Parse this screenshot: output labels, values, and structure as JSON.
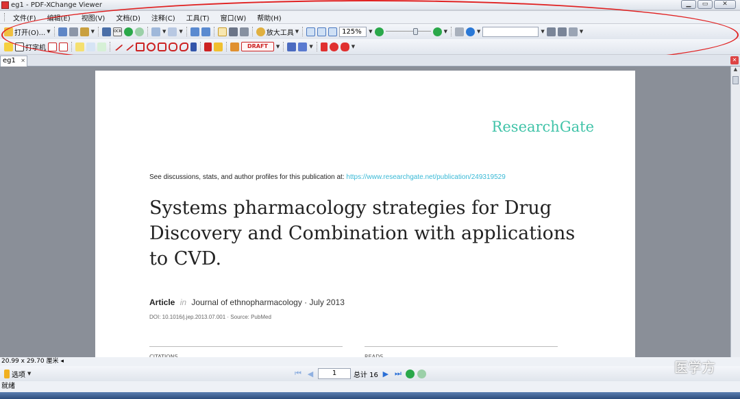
{
  "window": {
    "title": "eg1 - PDF-XChange Viewer",
    "buttons": [
      "▁",
      "▭",
      "✕"
    ]
  },
  "menu": [
    "文件(F)",
    "编辑(E)",
    "视图(V)",
    "文档(D)",
    "注释(C)",
    "工具(T)",
    "窗口(W)",
    "帮助(H)"
  ],
  "toolbar1": {
    "open_label": "打开(O)...",
    "zoom_tool_label": "放大工具",
    "zoom_level": "125%",
    "ocr_label": "OCR"
  },
  "toolbar2": {
    "typewriter_label": "打字机",
    "draft_stamp": "DRAFT"
  },
  "doctab": {
    "label": "eg1"
  },
  "page": {
    "logo": "ResearchGate",
    "see_text": "See discussions, stats, and author profiles for this publication at:",
    "url": "https://www.researchgate.net/publication/249319529",
    "title": "Systems pharmacology strategies for Drug Discovery and Combination with applications to CVD.",
    "article_type": "Article",
    "in_word": "in",
    "journal": "Journal of ethnopharmacology · July 2013",
    "doi": "DOI: 10.1016/j.jep.2013.07.001 · Source: PubMed",
    "stat_left": "CITATIONS",
    "stat_right": "READS"
  },
  "status": {
    "page_size": "20.99 x 29.70 厘米",
    "options_label": "选项",
    "page_number": "1",
    "total_pages": "总计 16",
    "ready": "就绪",
    "watermark": "医学方"
  },
  "colors": {
    "logo": "#40c3a8",
    "url": "#39b9d6",
    "annotation": "#e02020"
  }
}
